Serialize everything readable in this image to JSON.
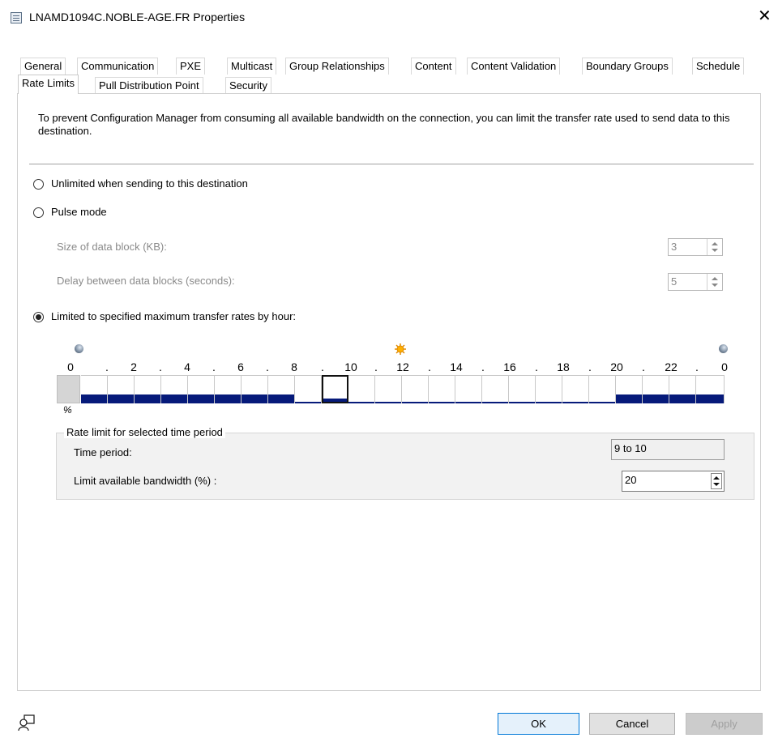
{
  "window": {
    "title": "LNAMD1094C.NOBLE-AGE.FR Properties",
    "close_glyph": "✕"
  },
  "tabs_row1": [
    "General",
    "Communication",
    "PXE",
    "Multicast",
    "Group Relationships",
    "Content",
    "Content Validation",
    "Boundary Groups",
    "Schedule"
  ],
  "tabs_row2": [
    "Rate Limits",
    "Pull Distribution Point",
    "Security"
  ],
  "selected_tab": "Rate Limits",
  "description": "To prevent Configuration Manager from consuming all available bandwidth on the connection, you can  limit the transfer rate used to send data to this destination.",
  "options": {
    "unlimited": "Unlimited when sending to this destination",
    "pulse": "Pulse mode",
    "limited": "Limited to specified maximum transfer rates by hour:",
    "selected": "limited"
  },
  "pulse": {
    "block_size_label": "Size of data block (KB):",
    "block_size_value": "3",
    "delay_label": "Delay between data blocks (seconds):",
    "delay_value": "5"
  },
  "schedule": {
    "hour_labels": [
      "0",
      "2",
      "4",
      "6",
      "8",
      "10",
      "12",
      "14",
      "16",
      "18",
      "20",
      "22",
      "0"
    ],
    "separator": ".",
    "percent_symbol": "%",
    "hourly_limit_fraction": [
      0.5,
      0.5,
      0.5,
      0.5,
      0.5,
      0.5,
      0.5,
      0.5,
      0.1,
      0.2,
      0.1,
      0.1,
      0.1,
      0.1,
      0.1,
      0.1,
      0.1,
      0.1,
      0.1,
      0.1,
      0.5,
      0.5,
      0.5,
      0.5
    ],
    "selected_hour": 9,
    "bar_color": "#061a7a"
  },
  "rate_group": {
    "legend": "Rate limit for selected time period",
    "time_period_label": "Time period:",
    "time_period_value": "9 to 10",
    "bandwidth_label": "Limit available bandwidth (%) :",
    "bandwidth_value": "20"
  },
  "buttons": {
    "ok": "OK",
    "cancel": "Cancel",
    "apply": "Apply"
  }
}
